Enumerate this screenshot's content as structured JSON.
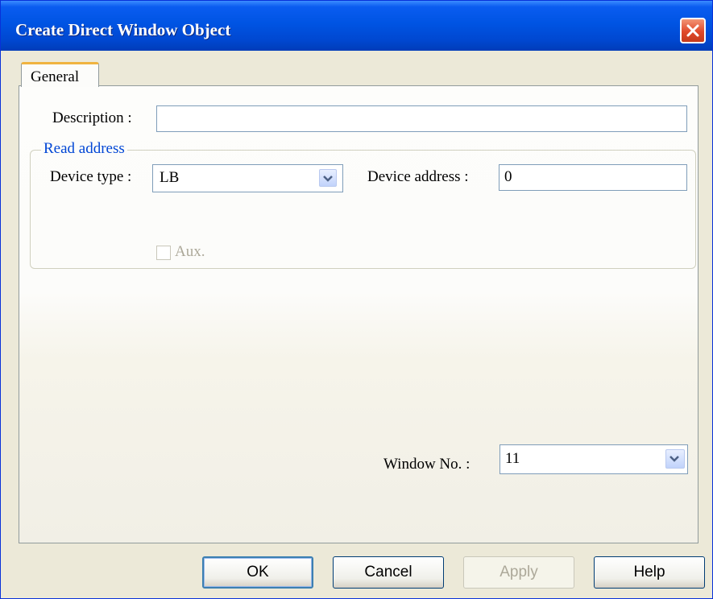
{
  "dialog": {
    "title": "Create Direct Window Object",
    "close_icon": "close-icon"
  },
  "tabs": [
    {
      "label": "General",
      "selected": true
    }
  ],
  "form": {
    "description": {
      "label": "Description :",
      "value": ""
    },
    "read_address": {
      "legend": "Read address",
      "device_type": {
        "label": "Device type :",
        "value": "LB"
      },
      "device_address": {
        "label": "Device address :",
        "value": "0"
      },
      "aux": {
        "label": "Aux.",
        "checked": false,
        "enabled": false
      }
    },
    "window_no": {
      "label": "Window No. :",
      "value": "11"
    }
  },
  "buttons": {
    "ok": "OK",
    "cancel": "Cancel",
    "apply": "Apply",
    "help": "Help"
  },
  "colors": {
    "titlebar": "#0054e3",
    "group_legend": "#0046d5",
    "close_button": "#e0492a"
  }
}
